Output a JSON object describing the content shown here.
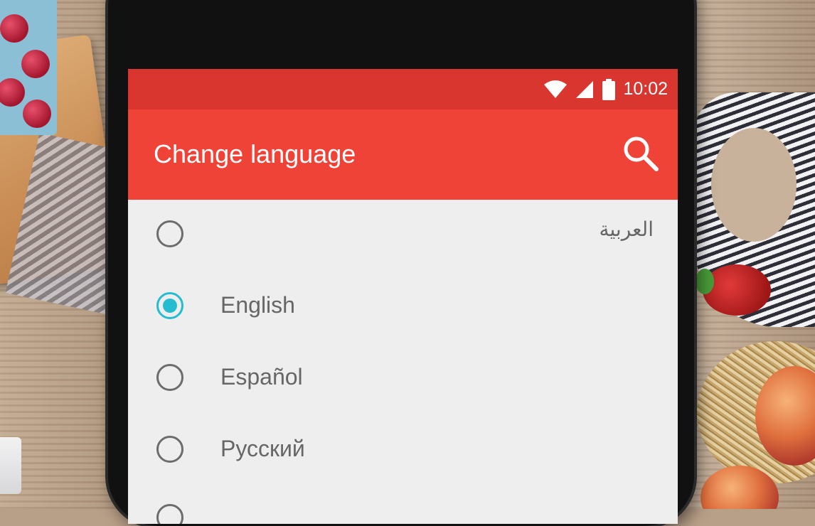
{
  "status_bar": {
    "time": "10:02",
    "icons": [
      "wifi-icon",
      "signal-icon",
      "battery-icon"
    ]
  },
  "app_bar": {
    "title": "Change language",
    "action_icon": "search-icon"
  },
  "languages": [
    {
      "label": "العربية",
      "selected": false
    },
    {
      "label": "English",
      "selected": true
    },
    {
      "label": "Español",
      "selected": false
    },
    {
      "label": "Русский",
      "selected": false
    }
  ],
  "colors": {
    "status_bar": "#d9362f",
    "app_bar": "#ef4338",
    "radio_selected": "#26bcd0",
    "radio_unselected": "#6c6c6c",
    "list_background": "#eeeeee"
  }
}
